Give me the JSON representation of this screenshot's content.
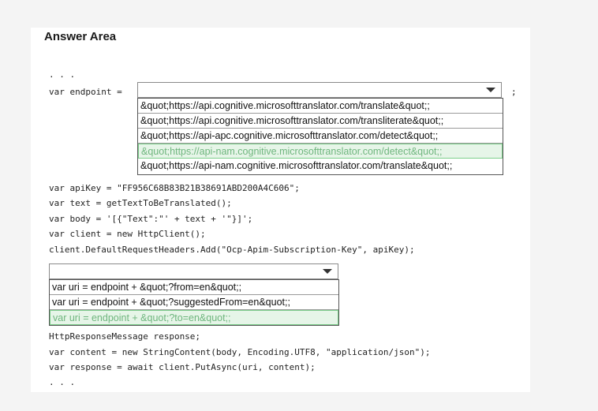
{
  "title": "Answer Area",
  "code": {
    "ellipsis_top": ". . .",
    "endpoint_prefix": "var endpoint = ",
    "endpoint_suffix": ";",
    "line_apikey": "var apiKey = \"FF956C68B83B21B38691ABD200A4C606\";",
    "line_text": "var text = getTextToBeTranslated();",
    "line_body": "var body = '[{\"Text\":\"' + text + '\"}]';",
    "line_client": "var client = new HttpClient();",
    "line_headers": "client.DefaultRequestHeaders.Add(\"Ocp-Apim-Subscription-Key\", apiKey);",
    "line_response_decl": "HttpResponseMessage response;",
    "line_content": "var content = new StringContent(body, Encoding.UTF8, \"application/json\");",
    "line_put": "var response = await client.PutAsync(uri, content);",
    "ellipsis_bottom": ". . ."
  },
  "endpoint_dropdown": {
    "selected_value": "",
    "options": [
      "&quot;https://api.cognitive.microsofttranslator.com/translate&quot;;",
      "&quot;https://api.cognitive.microsofttranslator.com/transliterate&quot;;",
      "&quot;https://api-apc.cognitive.microsofttranslator.com/detect&quot;;",
      "&quot;https://api-nam.cognitive.microsofttranslator.com/detect&quot;;",
      "&quot;https://api-nam.cognitive.microsofttranslator.com/translate&quot;;"
    ],
    "highlighted_index": 3
  },
  "uri_dropdown": {
    "selected_value": "",
    "options": [
      "var uri = endpoint + &quot;?from=en&quot;;",
      "var uri = endpoint + &quot;?suggestedFrom=en&quot;;",
      "var uri = endpoint + &quot;?to=en&quot;;"
    ],
    "highlighted_index": 2
  },
  "colors": {
    "highlight_bg": "#e6f5e8",
    "highlight_text": "#6fb67e",
    "highlight_border": "#7ccf8b"
  }
}
